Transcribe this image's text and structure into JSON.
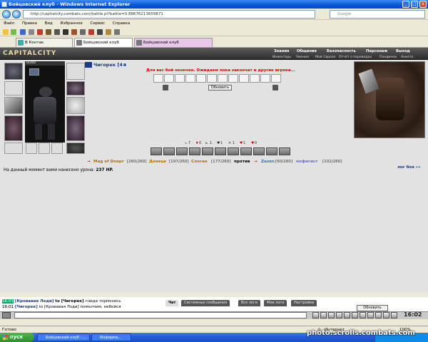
{
  "window": {
    "title": "Бойцовский клуб - Windows Internet Explorer",
    "min": "_",
    "max": "□",
    "close": "x"
  },
  "browser": {
    "back": "<",
    "forward": ">",
    "address": "http://capitalcity.combats.com/battle.pl?battle=0.88676213659871",
    "search_placeholder": "Google",
    "menu": [
      "Файл",
      "Правка",
      "Вид",
      "Избранное",
      "Сервис",
      "Справка"
    ],
    "tabs": [
      {
        "label": "В Контак"
      },
      {
        "label": "Бойцовский клуб"
      },
      {
        "label": "Бойцовский клуб"
      }
    ]
  },
  "site": {
    "logo": "CAPITALCITY",
    "nav": [
      "Знания",
      "Общение",
      "Безопасность",
      "Персонаж",
      "Выход"
    ],
    "subnav": [
      "Инвентарь",
      "Умения",
      "Мой Свроол",
      "Отчёт о переводах",
      "Поединки",
      "Анкета"
    ]
  },
  "player": {
    "hp": "0/260",
    "nick": "Чигорек [4]"
  },
  "battle": {
    "wait_message": "Для вас бой окончен. Ожидаем пока закончат и другие игроки...",
    "refresh": "Обновить",
    "stats": [
      "7",
      "0",
      "1",
      "1",
      "1",
      "1",
      "0"
    ],
    "team1": [
      {
        "name": "Mag of Dnepr",
        "hp": "[260/260]"
      },
      {
        "name": "Донецк",
        "hp": "[197/260]"
      },
      {
        "name": "Слоган",
        "hp": "[177/260]"
      }
    ],
    "versus": "против",
    "team2": [
      {
        "name": "Zazen",
        "hp": "[60/260]"
      },
      {
        "name": "пофегист",
        "hp": "[102/260]"
      }
    ],
    "damage_text": "На данный момент вами нанесено урона:",
    "damage_value": "237 HP.",
    "log_link": "лог боя »»"
  },
  "chat": {
    "lines": [
      {
        "time": "16:01",
        "from": "[Кровавая Леди]",
        "to": "to [Чигорек]",
        "text": "гнида тормозись"
      },
      {
        "time": "16:01",
        "from": "[Чигорек]",
        "to": "to [Кровавая Лэди]",
        "text": "помолчим, небойся"
      }
    ],
    "tabs": [
      "Чат",
      "Системные сообщения",
      "Все логи",
      "Мои логи",
      "Настройки"
    ],
    "refresh": "Обновить",
    "clock": "16:02"
  },
  "statusbar": {
    "left": "Готово",
    "zone": "Интернет",
    "zoom": "100%"
  },
  "taskbar": {
    "start": "пуск",
    "items": [
      "Бойцовский клуб - ...",
      "Информа..."
    ],
    "watermark": "photo.scrolls.combats.com"
  }
}
